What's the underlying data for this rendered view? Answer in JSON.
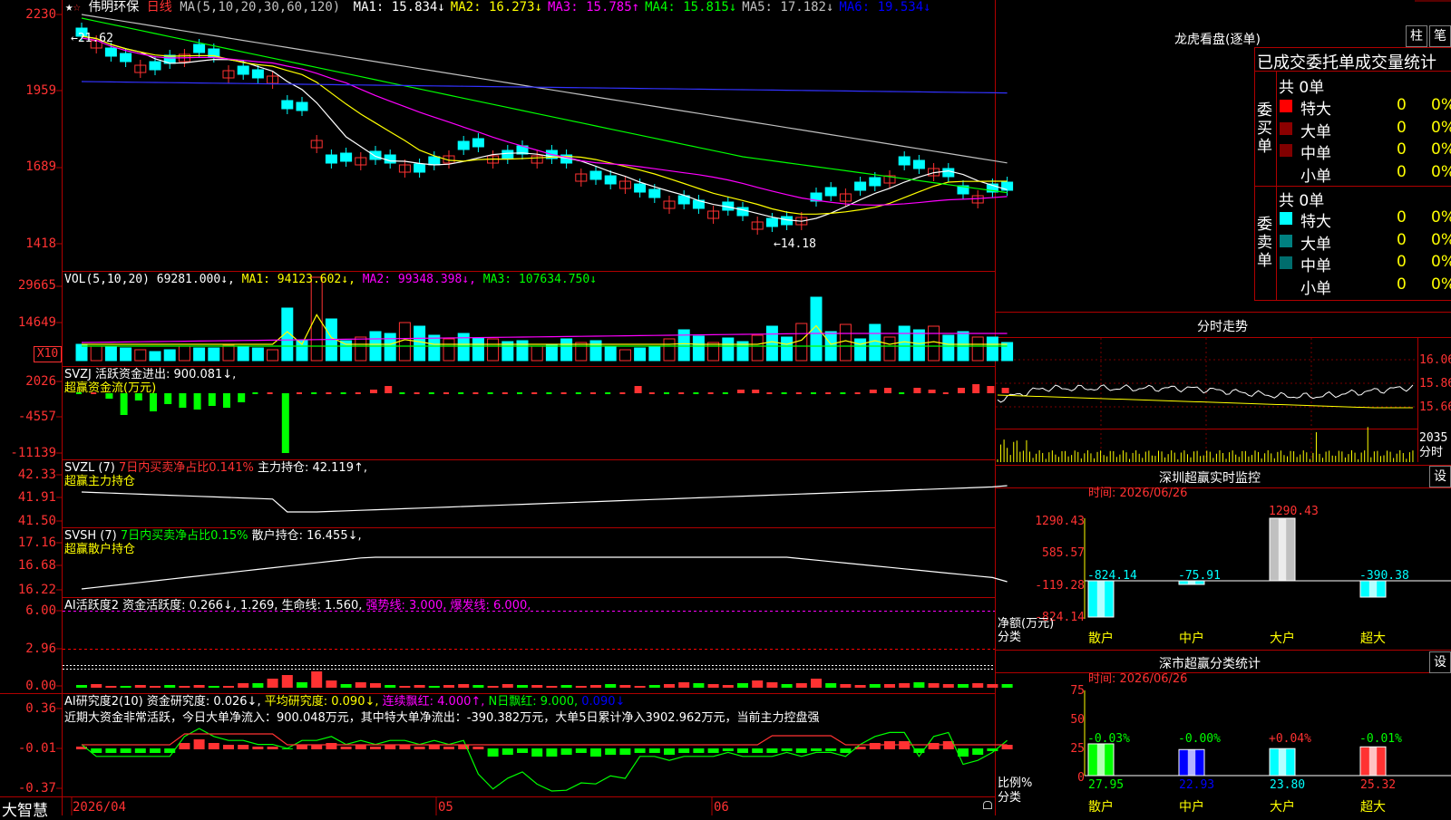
{
  "app": {
    "name": "大智慧"
  },
  "stock": {
    "name": "伟明环保",
    "period": "日线"
  },
  "ma_line": {
    "prefix": "MA(5,10,20,30,60,120)",
    "items": [
      {
        "label": "MA1:",
        "value": "15.834↓",
        "color": "#ffffff"
      },
      {
        "label": "MA2:",
        "value": "16.273↓",
        "color": "#ffff00"
      },
      {
        "label": "MA3:",
        "value": "15.785↑",
        "color": "#ff00ff"
      },
      {
        "label": "MA4:",
        "value": "15.815↓",
        "color": "#00ff00"
      },
      {
        "label": "MA5:",
        "value": "17.182↓",
        "color": "#c0c0c0"
      },
      {
        "label": "MA6:",
        "value": "19.534↓",
        "color": "#0000ff"
      }
    ]
  },
  "price_axis": [
    "2230",
    "1959",
    "1689",
    "1418"
  ],
  "price_marks": {
    "high": "21.62",
    "low": "←14.18"
  },
  "vol": {
    "header": "VOL(5,10,20)",
    "value": "69281.000↓,",
    "ma1": "MA1: 94123.602↓,",
    "ma2": "MA2: 99348.398↓,",
    "ma3": "MA3: 107634.750↓",
    "axis": [
      "29665",
      "14649"
    ],
    "unit": "X10"
  },
  "svzj": {
    "header": "SVZJ  活跃资金进出: 900.081↓,",
    "sub": "超赢资金流(万元)",
    "axis": [
      "2026",
      "-4557",
      "-11139"
    ]
  },
  "svzl": {
    "header_a": "SVZL (7)",
    "header_b": "7日内买卖净占比0.141%",
    "header_c": "主力持仓: 42.119↑,",
    "sub": "超赢主力持仓",
    "axis": [
      "42.33",
      "41.91",
      "41.50"
    ]
  },
  "svsh": {
    "header_a": "SVSH (7)",
    "header_b": "7日内买卖净占比0.15%",
    "header_c": "散户持仓: 16.455↓,",
    "sub": "超赢散户持仓",
    "axis": [
      "17.16",
      "16.68",
      "16.22"
    ]
  },
  "ai1": {
    "header_a": "AI活跃度2",
    "header_b": "资金活跃度: 0.266↓, 1.269, 生命线: 1.560,",
    "header_c": "强势线: 3.000, 爆发线: 6.000,",
    "axis": [
      "6.00",
      "2.96",
      "0.00"
    ]
  },
  "ai2": {
    "header_a": "AI研究度2(10)",
    "header_b": "资金研究度: 0.026↓,",
    "header_c": "平均研究度: 0.090↓,",
    "header_d": "连续飘红: 4.000↑,",
    "header_e": "N日飘红: 9.000,",
    "header_f": "0.090↓",
    "comment": "近期大资金非常活跃，今日大单净流入：900.048万元，其中特大单净流出：-390.382万元，大单5日累计净入3902.962万元，当前主力控盘强",
    "axis": [
      "0.36",
      "-0.01",
      "-0.37"
    ]
  },
  "date_axis": [
    "2026/04",
    "05",
    "06"
  ],
  "lhkp": {
    "title": "龙虎看盘(逐单)",
    "btn1": "柱",
    "btn2": "笔",
    "sub": "已成交委托单成交量统计",
    "buy_label": "委买单",
    "sell_label": "委卖单",
    "buy_total": "共 0单",
    "sell_total": "共 0单",
    "buy_rows": [
      {
        "name": "特大",
        "count": "0",
        "pct": "0%",
        "color": "#ff0000"
      },
      {
        "name": "大单",
        "count": "0",
        "pct": "0%",
        "color": "#8b0000"
      },
      {
        "name": "中单",
        "count": "0",
        "pct": "0%",
        "color": "#800000"
      },
      {
        "name": "小单",
        "count": "0",
        "pct": "0%",
        "color": ""
      }
    ],
    "sell_rows": [
      {
        "name": "特大",
        "count": "0",
        "pct": "0%",
        "color": "#00ffff"
      },
      {
        "name": "大单",
        "count": "0",
        "pct": "0%",
        "color": "#008080"
      },
      {
        "name": "中单",
        "count": "0",
        "pct": "0%",
        "color": "#006d6d"
      },
      {
        "name": "小单",
        "count": "0",
        "pct": "0%",
        "color": ""
      }
    ]
  },
  "intraday": {
    "title": "分时走势",
    "axis": [
      "16.06",
      "15.86",
      "15.66"
    ],
    "vol_axis": "2035",
    "vol_label": "分时"
  },
  "monitor": {
    "title": "深圳超赢实时监控",
    "btn": "设",
    "time": "时间: 2026/06/26",
    "axis": [
      "1290.43",
      "585.57",
      "-119.28",
      "-824.14"
    ],
    "ylabel": "净额(万元)",
    "xlabel": "分类",
    "categories": [
      "散户",
      "中户",
      "大户",
      "超大"
    ],
    "values": [
      "-824.14",
      "-75.91",
      "1290.43",
      "-390.38"
    ]
  },
  "classify": {
    "title": "深市超赢分类统计",
    "btn": "设",
    "time": "时间: 2026/06/26",
    "axis": [
      "75",
      "50",
      "25",
      "0"
    ],
    "ylabel": "比例%",
    "xlabel": "分类",
    "categories": [
      "散户",
      "中户",
      "大户",
      "超大"
    ],
    "changes": [
      "-0.03%",
      "-0.00%",
      "+0.04%",
      "-0.01%"
    ],
    "values": [
      "27.95",
      "22.93",
      "23.80",
      "25.32"
    ]
  }
}
